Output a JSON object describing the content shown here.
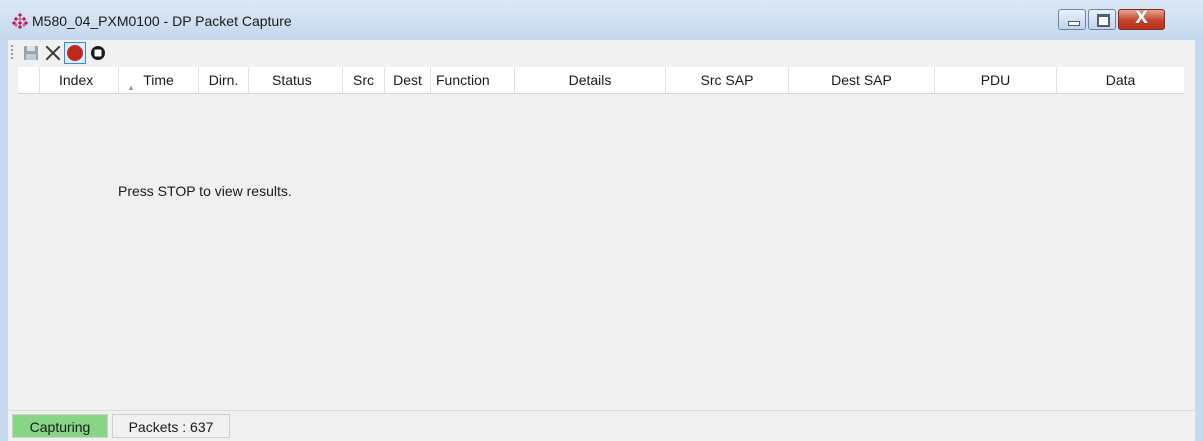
{
  "window": {
    "title": "M580_04_PXM0100 - DP Packet Capture",
    "icon": "app-diamond-icon",
    "controls": {
      "minimize": "minimize-icon",
      "maximize": "maximize-icon",
      "close_glyph": "X"
    }
  },
  "toolbar": {
    "buttons": [
      {
        "name": "save",
        "icon": "save-icon"
      },
      {
        "name": "clear",
        "icon": "close-icon"
      },
      {
        "name": "record",
        "icon": "record-icon"
      },
      {
        "name": "stop",
        "icon": "stop-icon"
      }
    ]
  },
  "grid": {
    "columns": [
      "",
      "Index",
      "Time",
      "Dirn.",
      "Status",
      "Src",
      "Dest",
      "Function",
      "Details",
      "Src SAP",
      "Dest SAP",
      "PDU",
      "Data"
    ],
    "sorted_column": "Index",
    "empty_message": "Press STOP to view results."
  },
  "status": {
    "state": "Capturing",
    "packets": "Packets : 637"
  },
  "colors": {
    "record": "#c0281c",
    "capturing_bg": "#86d686",
    "close_button": "#c3432b"
  }
}
